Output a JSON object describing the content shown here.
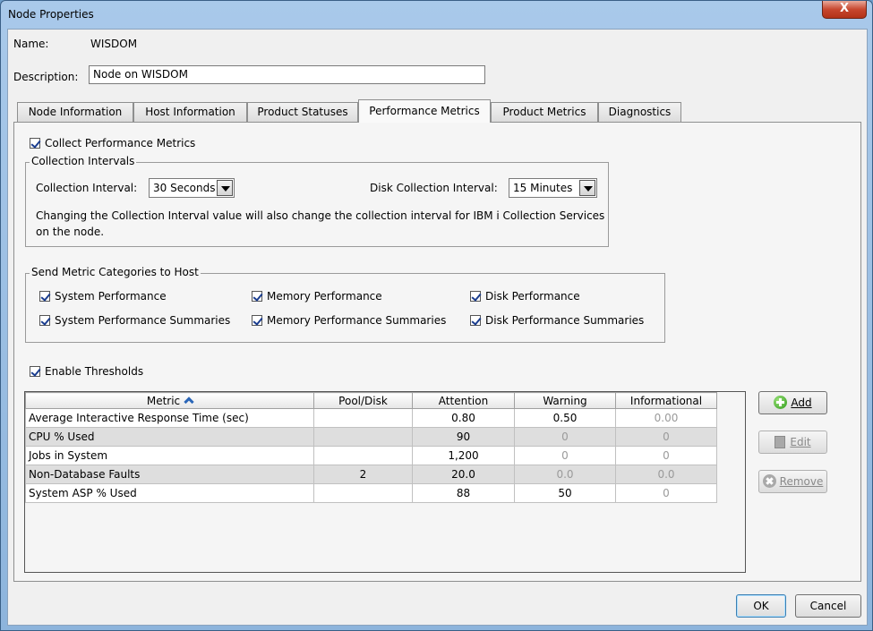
{
  "window": {
    "title": "Node Properties",
    "close_glyph": "X"
  },
  "general": {
    "name_label": "Name:",
    "name_value": "WISDOM",
    "description_label": "Description:",
    "description_value": "Node on WISDOM"
  },
  "tabs": [
    {
      "label": "Node Information",
      "active": false
    },
    {
      "label": "Host Information",
      "active": false
    },
    {
      "label": "Product Statuses",
      "active": false
    },
    {
      "label": "Performance Metrics",
      "active": true
    },
    {
      "label": "Product Metrics",
      "active": false
    },
    {
      "label": "Diagnostics",
      "active": false
    }
  ],
  "performance": {
    "collect_label": "Collect Performance Metrics",
    "collect_checked": true,
    "intervals": {
      "group_title": "Collection Intervals",
      "collection_label": "Collection Interval:",
      "collection_value": "30 Seconds",
      "disk_label": "Disk Collection Interval:",
      "disk_value": "15 Minutes",
      "note_line1": "Changing the Collection Interval value will also change the collection interval for IBM i Collection Services",
      "note_line2": "on the node."
    },
    "categories": {
      "group_title": "Send Metric Categories to Host",
      "items": [
        {
          "label": "System Performance",
          "checked": true
        },
        {
          "label": "Memory Performance",
          "checked": true
        },
        {
          "label": "Disk Performance",
          "checked": true
        },
        {
          "label": "System Performance Summaries",
          "checked": true
        },
        {
          "label": "Memory Performance Summaries",
          "checked": true
        },
        {
          "label": "Disk Performance Summaries",
          "checked": true
        }
      ]
    },
    "thresholds_label": "Enable Thresholds",
    "thresholds_checked": true,
    "table": {
      "columns": [
        "Metric",
        "Pool/Disk",
        "Attention",
        "Warning",
        "Informational"
      ],
      "sort_column": "Metric",
      "sort_direction": "ascending",
      "rows": [
        {
          "metric": "Average Interactive Response Time (sec)",
          "pool": "",
          "attention": "0.80",
          "warning": "0.50",
          "informational": "0.00"
        },
        {
          "metric": "CPU % Used",
          "pool": "",
          "attention": "90",
          "warning": "0",
          "informational": "0"
        },
        {
          "metric": "Jobs in System",
          "pool": "",
          "attention": "1,200",
          "warning": "0",
          "informational": "0"
        },
        {
          "metric": "Non-Database Faults",
          "pool": "2",
          "attention": "20.0",
          "warning": "0.0",
          "informational": "0.0"
        },
        {
          "metric": "System ASP % Used",
          "pool": "",
          "attention": "88",
          "warning": "50",
          "informational": "0"
        }
      ]
    },
    "buttons": {
      "add_label": "Add",
      "edit_label": "Edit",
      "remove_label": "Remove"
    }
  },
  "footer": {
    "ok_label": "OK",
    "cancel_label": "Cancel"
  },
  "colors": {
    "title_bar": "#8db4dc",
    "close_button": "#c7472f",
    "add_icon": "#2e9a1a",
    "checkmark": "#1a3d8f"
  }
}
